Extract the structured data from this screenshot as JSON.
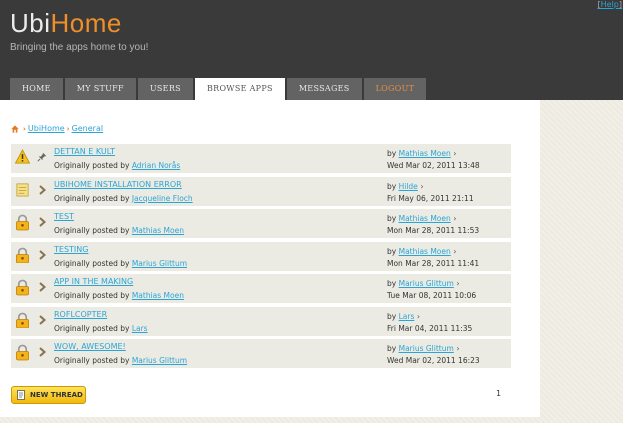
{
  "header": {
    "help_label": "Help",
    "logo_ubi": "Ubi",
    "logo_home": "Home",
    "tagline": "Bringing the apps home to you!"
  },
  "nav": {
    "tabs": [
      {
        "label": "HOME"
      },
      {
        "label": "MY STUFF"
      },
      {
        "label": "USERS"
      },
      {
        "label": "BROWSE APPS"
      },
      {
        "label": "MESSAGES"
      },
      {
        "label": "LOGOUT"
      }
    ],
    "active_tab": "BROWSE APPS"
  },
  "breadcrumb": {
    "items": [
      {
        "label": "UbiHome"
      },
      {
        "label": "General"
      }
    ]
  },
  "threads": [
    {
      "title": "DETTAN E KULT",
      "prefix": "Originally posted by",
      "author": "Adrian Norås",
      "by": "by",
      "last_poster": "Mathias Moen",
      "date": "Wed Mar 02, 2011 13:48",
      "status_icon": "warning-icon",
      "marker_icon": "pin-icon"
    },
    {
      "title": "UBIHOME INSTALLATION ERROR",
      "prefix": "Originally posted by",
      "author": "Jacqueline Floch",
      "by": "by",
      "last_poster": "Hilde",
      "date": "Fri May 06, 2011 21:11",
      "status_icon": "note-icon",
      "marker_icon": "arrow-right-icon"
    },
    {
      "title": "TEST",
      "prefix": "Originally posted by",
      "author": "Mathias Moen",
      "by": "by",
      "last_poster": "Mathias Moen",
      "date": "Mon Mar 28, 2011 11:53",
      "status_icon": "lock-icon",
      "marker_icon": "arrow-right-icon"
    },
    {
      "title": "TESTING",
      "prefix": "Originally posted by",
      "author": "Marius Glittum",
      "by": "by",
      "last_poster": "Mathias Moen",
      "date": "Mon Mar 28, 2011 11:41",
      "status_icon": "lock-icon",
      "marker_icon": "arrow-right-icon"
    },
    {
      "title": "APP IN THE MAKING",
      "prefix": "Originally posted by",
      "author": "Mathias Moen",
      "by": "by",
      "last_poster": "Marius Glittum",
      "date": "Tue Mar 08, 2011 10:06",
      "status_icon": "lock-icon",
      "marker_icon": "arrow-right-icon"
    },
    {
      "title": "ROFLCOPTER",
      "prefix": "Originally posted by",
      "author": "Lars",
      "by": "by",
      "last_poster": "Lars",
      "date": "Fri Mar 04, 2011 11:35",
      "status_icon": "lock-icon",
      "marker_icon": "arrow-right-icon"
    },
    {
      "title": "WOW, AWESOME!",
      "prefix": "Originally posted by",
      "author": "Marius Glittum",
      "by": "by",
      "last_poster": "Marius Glittum",
      "date": "Wed Mar 02, 2011 16:23",
      "status_icon": "lock-icon",
      "marker_icon": "arrow-right-icon"
    }
  ],
  "new_thread_label": "NEW THREAD",
  "pagination": {
    "current_page": "1"
  },
  "colors": {
    "header_bg": "#3a3a3a",
    "accent_orange": "#f08e2a",
    "link_blue": "#2aa5d6",
    "tab_bg": "#636363",
    "row_bg": "#ecebe3",
    "button_yellow": "#f2b90a"
  }
}
